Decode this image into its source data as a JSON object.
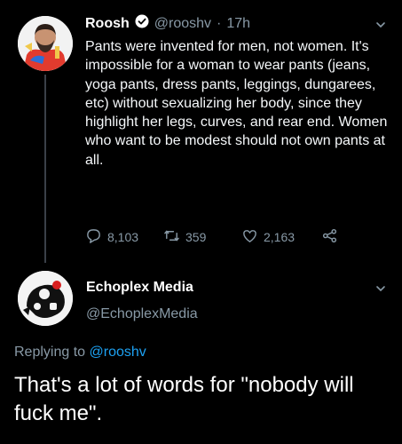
{
  "tweet": {
    "author_name": "Roosh",
    "handle": "@rooshv",
    "separator": "·",
    "time": "17h",
    "text": "Pants were invented for men, not women. It's impossible for a woman to wear pants (jeans, yoga pants, dress pants, leggings, dungarees, etc) without sexualizing her body, since they highlight her legs, curves, and rear end. Women who want to be modest should not own pants at all.",
    "replies": "8,103",
    "retweets": "359",
    "likes": "2,163"
  },
  "reply": {
    "author_name": "Echoplex Media",
    "handle": "@EchoplexMedia",
    "replying_prefix": "Replying to",
    "replying_to": "@rooshv",
    "text": "That's a lot of words for \"nobody will fuck me\"."
  },
  "colors": {
    "background": "#000000",
    "secondary_text": "#8899a6",
    "link": "#1da1f2",
    "verified": "#ffffff"
  },
  "icons": [
    "verified-badge-icon",
    "chevron-down-icon",
    "reply-icon",
    "retweet-icon",
    "like-icon",
    "share-icon"
  ]
}
